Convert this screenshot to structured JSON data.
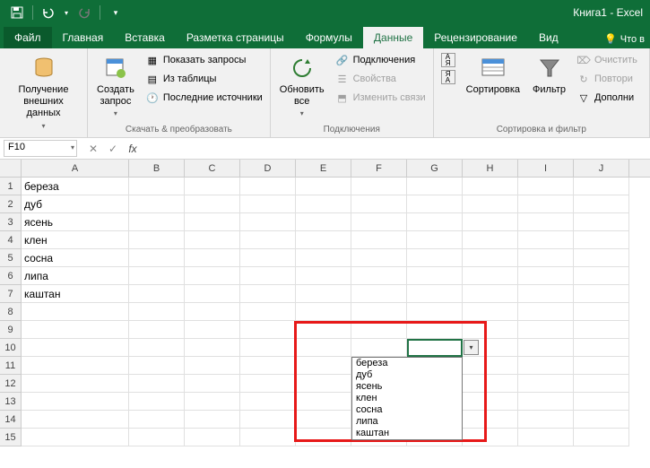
{
  "title": "Книга1 - Excel",
  "tabs": {
    "file": "Файл",
    "list": [
      "Главная",
      "Вставка",
      "Разметка страницы",
      "Формулы",
      "Данные",
      "Рецензирование",
      "Вид"
    ],
    "active": 4,
    "help": "Что в"
  },
  "ribbon": {
    "g1": {
      "label": "",
      "btn": "Получение\nвнешних данных"
    },
    "g2": {
      "label": "Скачать & преобразовать",
      "btn": "Создать\nзапрос",
      "items": [
        "Показать запросы",
        "Из таблицы",
        "Последние источники"
      ]
    },
    "g3": {
      "label": "Подключения",
      "btn": "Обновить\nвсе",
      "items": [
        "Подключения",
        "Свойства",
        "Изменить связи"
      ]
    },
    "g4": {
      "label": "Сортировка и фильтр",
      "sortAZ": "А↓Я",
      "sortZA": "Я↓А",
      "sort": "Сортировка",
      "filter": "Фильтр",
      "items": [
        "Очистить",
        "Повтори",
        "Дополни"
      ]
    }
  },
  "namebox": "F10",
  "columns": [
    "A",
    "B",
    "C",
    "D",
    "E",
    "F",
    "G",
    "H",
    "I",
    "J"
  ],
  "row_count": 15,
  "cells_A": [
    "береза",
    "дуб",
    "ясень",
    "клен",
    "сосна",
    "липа",
    "каштан"
  ],
  "dropdown_items": [
    "береза",
    "дуб",
    "ясень",
    "клен",
    "сосна",
    "липа",
    "каштан"
  ]
}
